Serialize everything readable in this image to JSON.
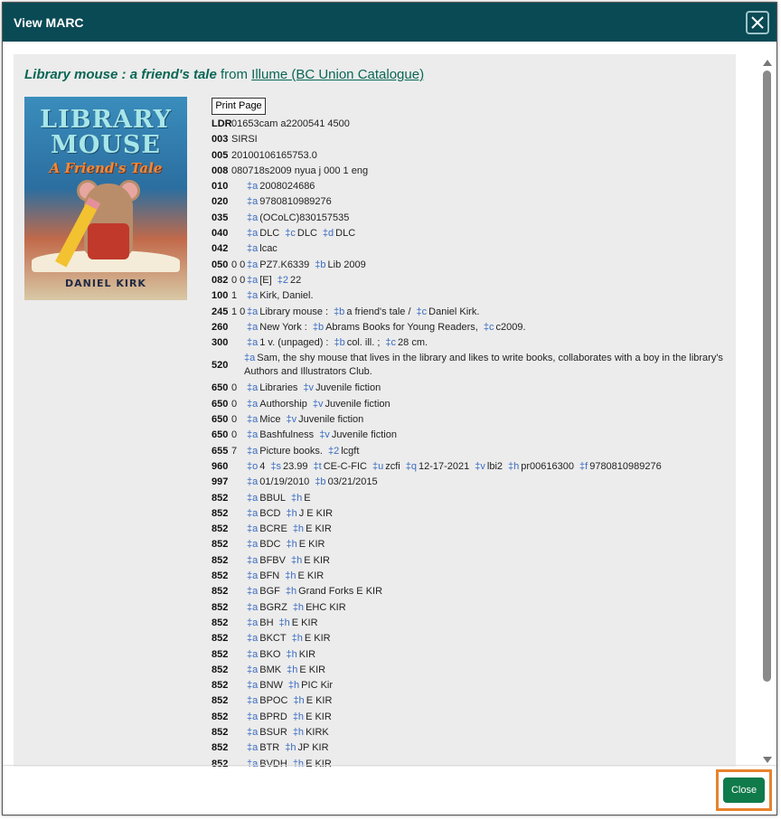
{
  "dialog": {
    "title": "View MARC",
    "close_button": "Close"
  },
  "heading": {
    "book_title": "Library mouse : a friend's tale",
    "from": "from",
    "source": "Illume (BC Union Catalogue)"
  },
  "cover": {
    "title_line1": "LIBRARY",
    "title_line2": "MOUSE",
    "subtitle": "A Friend's Tale",
    "author": "DANIEL KIRK"
  },
  "print_button": "Print Page",
  "marc_rows": [
    {
      "tag": "LDR",
      "ind": "",
      "text": "01653cam a2200541 4500"
    },
    {
      "tag": "003",
      "ind": "",
      "text": "SIRSI"
    },
    {
      "tag": "005",
      "ind": "",
      "text": "20100106165753.0"
    },
    {
      "tag": "008",
      "ind": "",
      "text": "080718s2009 nyua j 000 1 eng"
    },
    {
      "tag": "010",
      "ind": "",
      "subfields": [
        [
          "‡a",
          "2008024686"
        ]
      ]
    },
    {
      "tag": "020",
      "ind": "",
      "subfields": [
        [
          "‡a",
          "9780810989276"
        ]
      ]
    },
    {
      "tag": "035",
      "ind": "",
      "subfields": [
        [
          "‡a",
          "(OCoLC)830157535"
        ]
      ]
    },
    {
      "tag": "040",
      "ind": "",
      "subfields": [
        [
          "‡a",
          "DLC"
        ],
        [
          "‡c",
          "DLC"
        ],
        [
          "‡d",
          "DLC"
        ]
      ]
    },
    {
      "tag": "042",
      "ind": "",
      "subfields": [
        [
          "‡a",
          "lcac"
        ]
      ]
    },
    {
      "tag": "050",
      "ind": "0 0",
      "subfields": [
        [
          "‡a",
          "PZ7.K6339"
        ],
        [
          "‡b",
          "Lib 2009"
        ]
      ]
    },
    {
      "tag": "082",
      "ind": "0 0",
      "subfields": [
        [
          "‡a",
          "[E]"
        ],
        [
          "‡2",
          "22"
        ]
      ]
    },
    {
      "tag": "100",
      "ind": "1",
      "subfields": [
        [
          "‡a",
          "Kirk, Daniel."
        ]
      ]
    },
    {
      "tag": "245",
      "ind": "1 0",
      "subfields": [
        [
          "‡a",
          "Library mouse :"
        ],
        [
          "‡b",
          "a friend's tale /"
        ],
        [
          "‡c",
          "Daniel Kirk."
        ]
      ]
    },
    {
      "tag": "260",
      "ind": "",
      "subfields": [
        [
          "‡a",
          "New York :"
        ],
        [
          "‡b",
          "Abrams Books for Young Readers,"
        ],
        [
          "‡c",
          "c2009."
        ]
      ]
    },
    {
      "tag": "300",
      "ind": "",
      "subfields": [
        [
          "‡a",
          "1 v. (unpaged) :"
        ],
        [
          "‡b",
          "col. ill. ;"
        ],
        [
          "‡c",
          "28 cm."
        ]
      ]
    },
    {
      "tag": "520",
      "ind": "",
      "wrap": true,
      "subfields": [
        [
          "‡a",
          "Sam, the shy mouse that lives in the library and likes to write books, collaborates with a boy in the library's Authors and Illustrators Club."
        ]
      ]
    },
    {
      "tag": "650",
      "ind": "0",
      "subfields": [
        [
          "‡a",
          "Libraries"
        ],
        [
          "‡v",
          "Juvenile fiction"
        ]
      ]
    },
    {
      "tag": "650",
      "ind": "0",
      "subfields": [
        [
          "‡a",
          "Authorship"
        ],
        [
          "‡v",
          "Juvenile fiction"
        ]
      ]
    },
    {
      "tag": "650",
      "ind": "0",
      "subfields": [
        [
          "‡a",
          "Mice"
        ],
        [
          "‡v",
          "Juvenile fiction"
        ]
      ]
    },
    {
      "tag": "650",
      "ind": "0",
      "subfields": [
        [
          "‡a",
          "Bashfulness"
        ],
        [
          "‡v",
          "Juvenile fiction"
        ]
      ]
    },
    {
      "tag": "655",
      "ind": "7",
      "subfields": [
        [
          "‡a",
          "Picture books."
        ],
        [
          "‡2",
          "lcgft"
        ]
      ]
    },
    {
      "tag": "960",
      "ind": "",
      "subfields": [
        [
          "‡o",
          "4"
        ],
        [
          "‡s",
          "23.99"
        ],
        [
          "‡t",
          "CE-C-FIC"
        ],
        [
          "‡u",
          "zcfi"
        ],
        [
          "‡q",
          "12-17-2021"
        ],
        [
          "‡v",
          "lbi2"
        ],
        [
          "‡h",
          "pr00616300"
        ],
        [
          "‡f",
          "9780810989276"
        ]
      ]
    },
    {
      "tag": "997",
      "ind": "",
      "subfields": [
        [
          "‡a",
          "01/19/2010"
        ],
        [
          "‡b",
          "03/21/2015"
        ]
      ]
    },
    {
      "tag": "852",
      "ind": "",
      "subfields": [
        [
          "‡a",
          "BBUL"
        ],
        [
          "‡h",
          "E"
        ]
      ]
    },
    {
      "tag": "852",
      "ind": "",
      "subfields": [
        [
          "‡a",
          "BCD"
        ],
        [
          "‡h",
          "J E KIR"
        ]
      ]
    },
    {
      "tag": "852",
      "ind": "",
      "subfields": [
        [
          "‡a",
          "BCRE"
        ],
        [
          "‡h",
          "E KIR"
        ]
      ]
    },
    {
      "tag": "852",
      "ind": "",
      "subfields": [
        [
          "‡a",
          "BDC"
        ],
        [
          "‡h",
          "E KIR"
        ]
      ]
    },
    {
      "tag": "852",
      "ind": "",
      "subfields": [
        [
          "‡a",
          "BFBV"
        ],
        [
          "‡h",
          "E KIR"
        ]
      ]
    },
    {
      "tag": "852",
      "ind": "",
      "subfields": [
        [
          "‡a",
          "BFN"
        ],
        [
          "‡h",
          "E KIR"
        ]
      ]
    },
    {
      "tag": "852",
      "ind": "",
      "subfields": [
        [
          "‡a",
          "BGF"
        ],
        [
          "‡h",
          "Grand Forks E KIR"
        ]
      ]
    },
    {
      "tag": "852",
      "ind": "",
      "subfields": [
        [
          "‡a",
          "BGRZ"
        ],
        [
          "‡h",
          "EHC KIR"
        ]
      ]
    },
    {
      "tag": "852",
      "ind": "",
      "subfields": [
        [
          "‡a",
          "BH"
        ],
        [
          "‡h",
          "E KIR"
        ]
      ]
    },
    {
      "tag": "852",
      "ind": "",
      "subfields": [
        [
          "‡a",
          "BKCT"
        ],
        [
          "‡h",
          "E KIR"
        ]
      ]
    },
    {
      "tag": "852",
      "ind": "",
      "subfields": [
        [
          "‡a",
          "BKO"
        ],
        [
          "‡h",
          "KIR"
        ]
      ]
    },
    {
      "tag": "852",
      "ind": "",
      "subfields": [
        [
          "‡a",
          "BMK"
        ],
        [
          "‡h",
          "E KIR"
        ]
      ]
    },
    {
      "tag": "852",
      "ind": "",
      "subfields": [
        [
          "‡a",
          "BNW"
        ],
        [
          "‡h",
          "PIC Kir"
        ]
      ]
    },
    {
      "tag": "852",
      "ind": "",
      "subfields": [
        [
          "‡a",
          "BPOC"
        ],
        [
          "‡h",
          "E KIR"
        ]
      ]
    },
    {
      "tag": "852",
      "ind": "",
      "subfields": [
        [
          "‡a",
          "BPRD"
        ],
        [
          "‡h",
          "E KIR"
        ]
      ]
    },
    {
      "tag": "852",
      "ind": "",
      "subfields": [
        [
          "‡a",
          "BSUR"
        ],
        [
          "‡h",
          "KIRK"
        ]
      ]
    },
    {
      "tag": "852",
      "ind": "",
      "subfields": [
        [
          "‡a",
          "BTR"
        ],
        [
          "‡h",
          "JP KIR"
        ]
      ]
    },
    {
      "tag": "852",
      "ind": "",
      "subfields": [
        [
          "‡a",
          "BVDH"
        ],
        [
          "‡h",
          "E KIR"
        ]
      ]
    }
  ],
  "colors": {
    "titlebar": "#0a4a55",
    "accent_link": "#0a6655",
    "subfield_code": "#3a6cc2",
    "close_button": "#0f7a4a",
    "highlight_border": "#e9822c"
  }
}
